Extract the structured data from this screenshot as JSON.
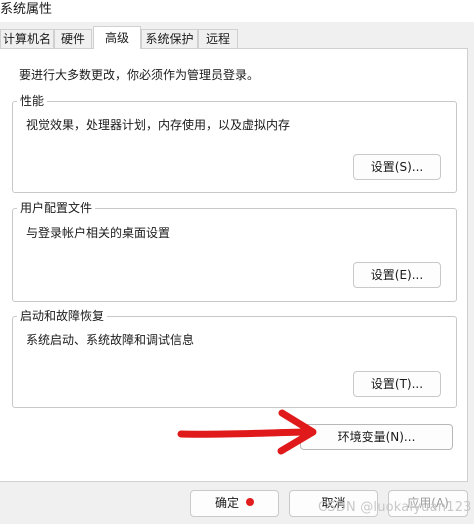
{
  "window": {
    "title": "系统属性"
  },
  "tabs": [
    {
      "label": "计算机名",
      "active": false
    },
    {
      "label": "硬件",
      "active": false
    },
    {
      "label": "高级",
      "active": true
    },
    {
      "label": "系统保护",
      "active": false
    },
    {
      "label": "远程",
      "active": false
    }
  ],
  "admin_note": "要进行大多数更改，你必须作为管理员登录。",
  "performance": {
    "title": "性能",
    "description": "视觉效果，处理器计划，内存使用，以及虚拟内存",
    "button": "设置(S)..."
  },
  "user_profiles": {
    "title": "用户配置文件",
    "description": "与登录帐户相关的桌面设置",
    "button": "设置(E)..."
  },
  "startup_recovery": {
    "title": "启动和故障恢复",
    "description": "系统启动、系统故障和调试信息",
    "button": "设置(T)..."
  },
  "env_button": "环境变量(N)...",
  "footer": {
    "ok": "确定",
    "cancel": "取消",
    "apply": "应用(A)"
  },
  "annotation": {
    "arrow_color": "#e01a1a"
  },
  "watermark": "CSDN @luokaiyuan123"
}
